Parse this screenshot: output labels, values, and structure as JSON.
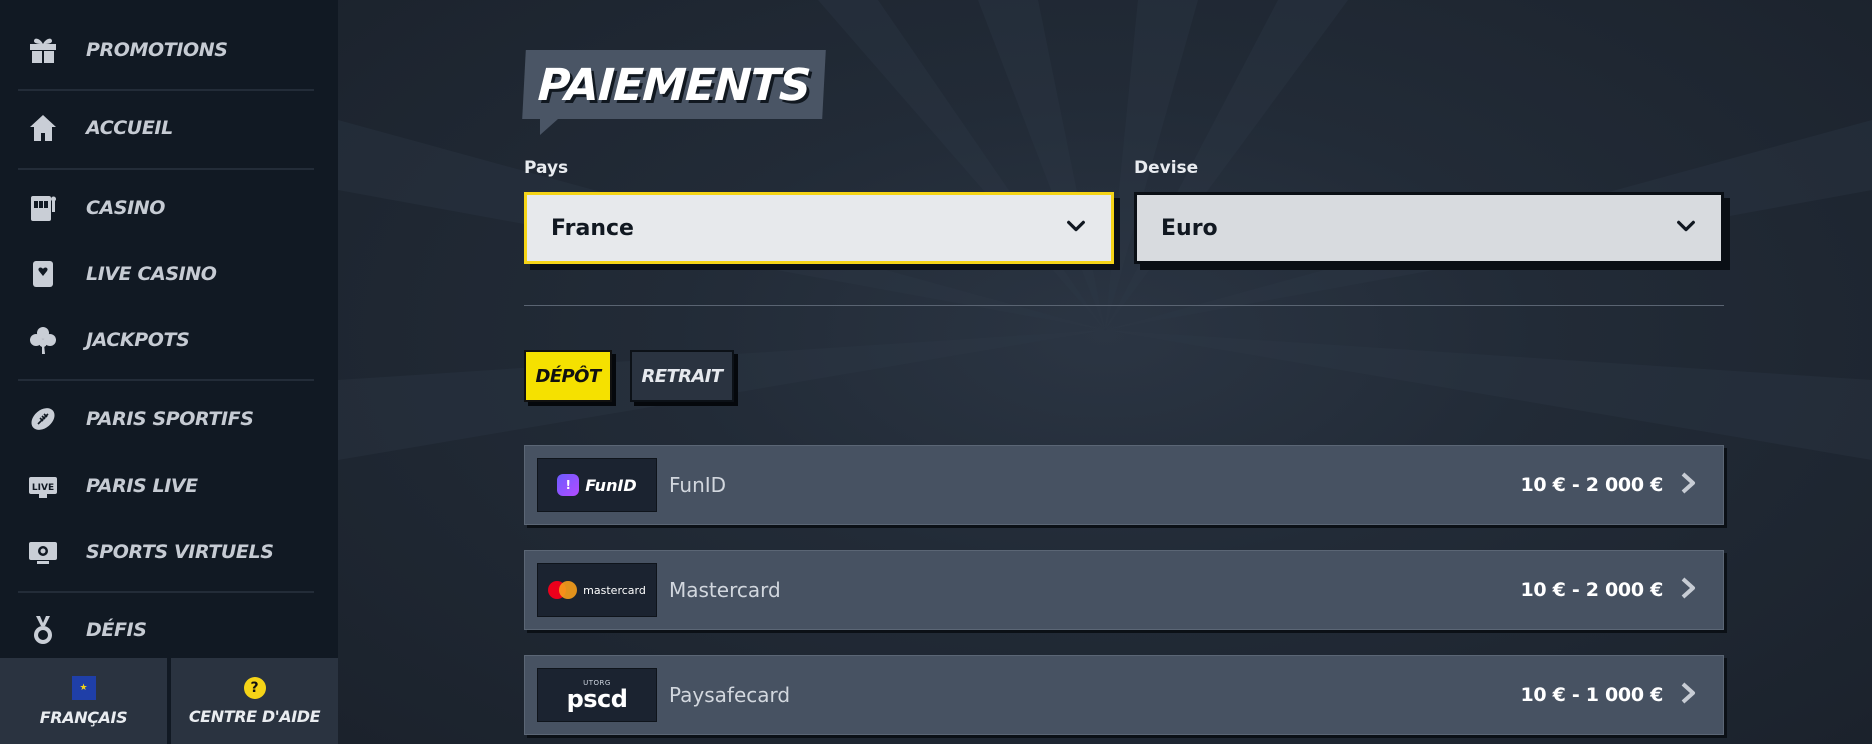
{
  "sidebar": {
    "items": [
      {
        "label": "PROMOTIONS",
        "icon": "gift-icon"
      },
      {
        "label": "ACCUEIL",
        "icon": "home-icon"
      },
      {
        "label": "CASINO",
        "icon": "slot-machine-icon"
      },
      {
        "label": "LIVE CASINO",
        "icon": "playing-card-icon"
      },
      {
        "label": "JACKPOTS",
        "icon": "clover-icon"
      },
      {
        "label": "PARIS SPORTIFS",
        "icon": "football-icon"
      },
      {
        "label": "PARIS LIVE",
        "icon": "live-tv-icon"
      },
      {
        "label": "SPORTS VIRTUELS",
        "icon": "virtual-sports-icon"
      },
      {
        "label": "DÉFIS",
        "icon": "medal-icon"
      }
    ],
    "footer": {
      "language_label": "FRANÇAIS",
      "help_label": "CENTRE D'AIDE",
      "help_glyph": "?"
    }
  },
  "main": {
    "title": "PAIEMENTS",
    "country": {
      "label": "Pays",
      "value": "France"
    },
    "currency": {
      "label": "Devise",
      "value": "Euro"
    },
    "tabs": [
      {
        "label": "DÉPÔT",
        "active": true
      },
      {
        "label": "RETRAIT",
        "active": false
      }
    ],
    "methods": [
      {
        "name": "FunID",
        "limits": "10 € - 2 000 €",
        "logo_text": "FunID"
      },
      {
        "name": "Mastercard",
        "limits": "10 € - 2 000 €",
        "logo_text": "mastercard"
      },
      {
        "name": "Paysafecard",
        "limits": "10 € - 1 000 €",
        "logo_text": "pscd",
        "logo_top": "UTORG"
      }
    ]
  },
  "colors": {
    "accent_yellow": "#f5e100",
    "sidebar_bg": "#111923",
    "row_bg": "#475262"
  }
}
